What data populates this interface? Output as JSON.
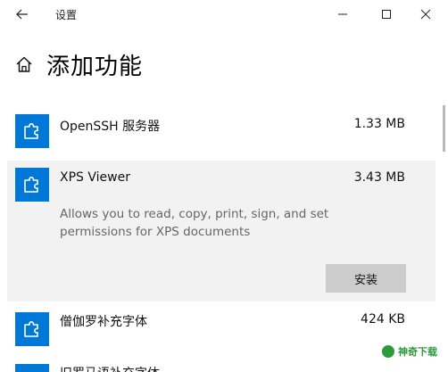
{
  "window": {
    "title": "设置"
  },
  "page": {
    "title": "添加功能"
  },
  "features": [
    {
      "name": "OpenSSH 服务器",
      "size": "1.33 MB"
    },
    {
      "name": "XPS Viewer",
      "size": "3.43 MB",
      "description": "Allows you to read, copy, print, sign, and set permissions for XPS documents",
      "install_label": "安装",
      "selected": true
    },
    {
      "name": "僧伽罗补充字体",
      "size": "424 KB"
    },
    {
      "name": "旧罗马语补充字体",
      "size": ""
    }
  ],
  "watermark": {
    "text": "神奇下载"
  },
  "colors": {
    "accent": "#0078d7",
    "selected_bg": "#f2f2f2",
    "button_bg": "#cccccc"
  }
}
